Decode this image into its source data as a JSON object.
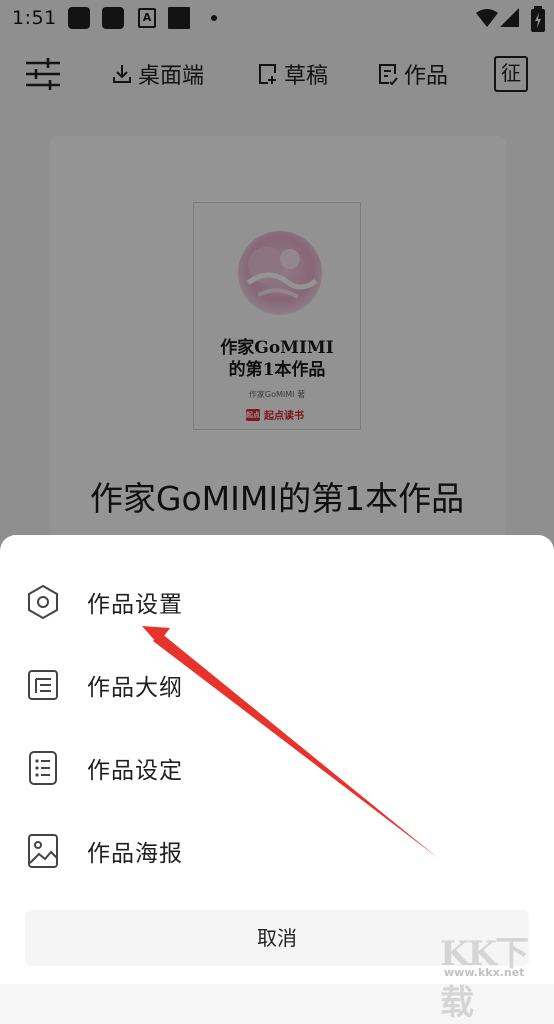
{
  "status_bar": {
    "time": "1:51",
    "font_icon_letter": "A"
  },
  "toolbar": {
    "desktop_label": "桌面端",
    "drafts_label": "草稿",
    "works_label": "作品",
    "zheng_label": "征"
  },
  "book": {
    "cover_title_line1": "作家GoMIMI",
    "cover_title_line2": "的第1本作品",
    "cover_author": "作家GoMIMI 著",
    "cover_brand": "起点读书",
    "cover_brand_logo": "起点",
    "title": "作家GoMIMI的第1本作品"
  },
  "sheet": {
    "items": [
      {
        "label": "作品设置",
        "icon": "hexagon-settings-icon"
      },
      {
        "label": "作品大纲",
        "icon": "outline-icon"
      },
      {
        "label": "作品设定",
        "icon": "list-icon"
      },
      {
        "label": "作品海报",
        "icon": "image-icon"
      }
    ],
    "cancel_label": "取消"
  },
  "annotation": {
    "arrow_color": "#e8322c"
  },
  "watermark": {
    "text": "KK下载",
    "url": "www.kkx.net"
  },
  "colors": {
    "overlay": "rgba(0,0,0,0.42)",
    "brand_red": "#d9262b"
  }
}
